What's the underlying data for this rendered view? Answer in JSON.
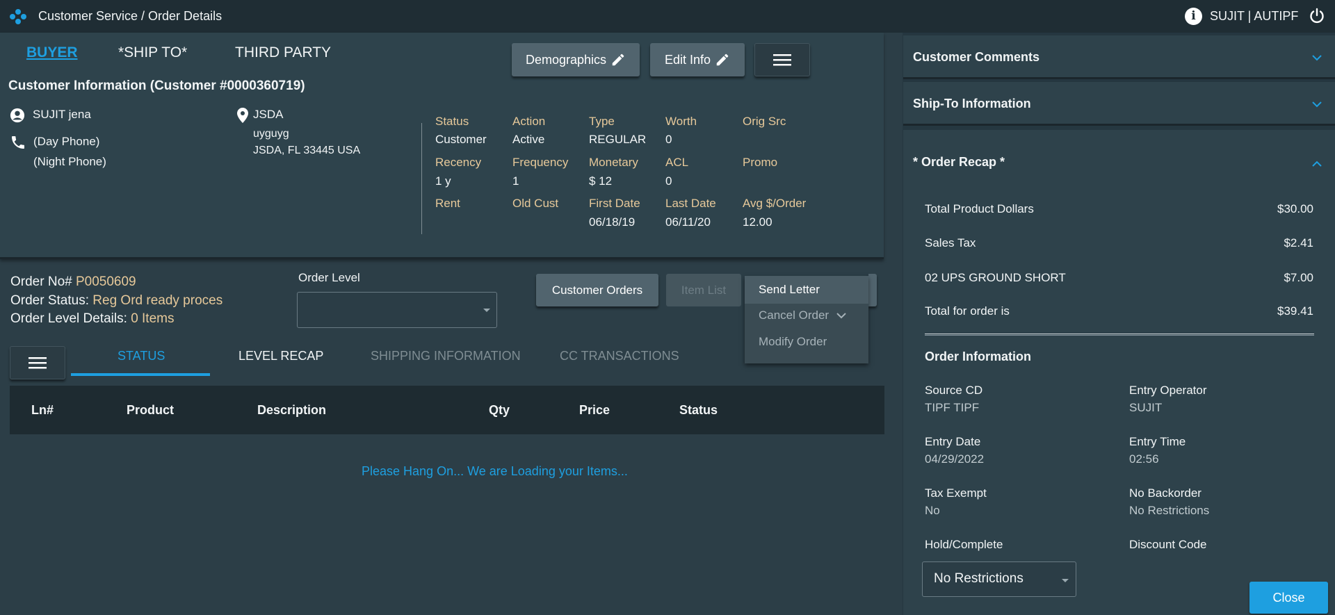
{
  "header": {
    "breadcrumb": "Customer Service / Order Details",
    "user": "SUJIT | AUTIPF",
    "info_icon": "i"
  },
  "customer_tabs": [
    "BUYER",
    "*SHIP TO*",
    "THIRD PARTY"
  ],
  "buttons": {
    "demographics": "Demographics",
    "edit_info": "Edit Info"
  },
  "customer": {
    "title": "Customer Information (Customer #0000360719)",
    "name": "SUJIT jena",
    "day_phone": "(Day Phone)",
    "night_phone": "(Night Phone)",
    "address_name": "JSDA",
    "address_line1": "uyguyg",
    "address_line2": "JSDA, FL 33445 USA"
  },
  "stats": [
    {
      "label": "Status",
      "value": "Customer"
    },
    {
      "label": "Action",
      "value": "Active"
    },
    {
      "label": "Type",
      "value": "REGULAR"
    },
    {
      "label": "Worth",
      "value": "0"
    },
    {
      "label": "Orig Src",
      "value": ""
    },
    {
      "label": "Recency",
      "value": "1 y"
    },
    {
      "label": "Frequency",
      "value": "1"
    },
    {
      "label": "Monetary",
      "value": "$ 12"
    },
    {
      "label": "ACL",
      "value": "0"
    },
    {
      "label": "Promo",
      "value": ""
    },
    {
      "label": "Rent",
      "value": ""
    },
    {
      "label": "Old Cust",
      "value": ""
    },
    {
      "label": "First Date",
      "value": "06/18/19"
    },
    {
      "label": "Last Date",
      "value": "06/11/20"
    },
    {
      "label": "Avg $/Order",
      "value": "12.00"
    }
  ],
  "order": {
    "no_label": "Order No#",
    "no_value": "P0050609",
    "status_label": "Order Status:",
    "status_value": "Reg Ord ready proces",
    "level_details_label": "Order Level Details:",
    "level_details_value": "0 Items",
    "order_level_label": "Order Level",
    "order_level_value": ""
  },
  "order_buttons": {
    "customer_orders": "Customer Orders",
    "item_list": "Item List"
  },
  "action_menu": [
    "Send Letter",
    "Cancel Order",
    "Modify Order"
  ],
  "sub_tabs": [
    "STATUS",
    "LEVEL RECAP",
    "SHIPPING INFORMATION",
    "CC TRANSACTIONS"
  ],
  "table": {
    "columns": [
      "Ln#",
      "Product",
      "Description",
      "Qty",
      "Price",
      "Status"
    ],
    "loading_message": "Please Hang On... We are Loading your Items..."
  },
  "right": {
    "customer_comments": "Customer Comments",
    "ship_to_information": "Ship-To Information",
    "order_recap_title": "* Order Recap *",
    "recap_rows": [
      {
        "label": "Total Product Dollars",
        "amount": "$30.00"
      },
      {
        "label": "Sales Tax",
        "amount": "$2.41"
      },
      {
        "label": "02 UPS GROUND SHORT",
        "amount": "$7.00"
      },
      {
        "label": "Total for order is",
        "amount": "$39.41"
      }
    ],
    "order_information_title": "Order Information",
    "order_info": [
      {
        "label": "Source CD",
        "value": "TIPF TIPF"
      },
      {
        "label": "Entry Operator",
        "value": "SUJIT"
      },
      {
        "label": "Entry Date",
        "value": "04/29/2022"
      },
      {
        "label": "Entry Time",
        "value": "02:56"
      },
      {
        "label": "Tax Exempt",
        "value": "No"
      },
      {
        "label": "No Backorder",
        "value": "No Restrictions"
      },
      {
        "label": "Hold/Complete",
        "value": ""
      },
      {
        "label": "Discount Code",
        "value": ""
      }
    ],
    "hold_select_value": "No Restrictions",
    "close_label": "Close"
  },
  "colors": {
    "accent": "#1e9fe0",
    "label_gold": "#e7c99a",
    "background": "#2c3e47",
    "topbar": "#1f2d34"
  }
}
